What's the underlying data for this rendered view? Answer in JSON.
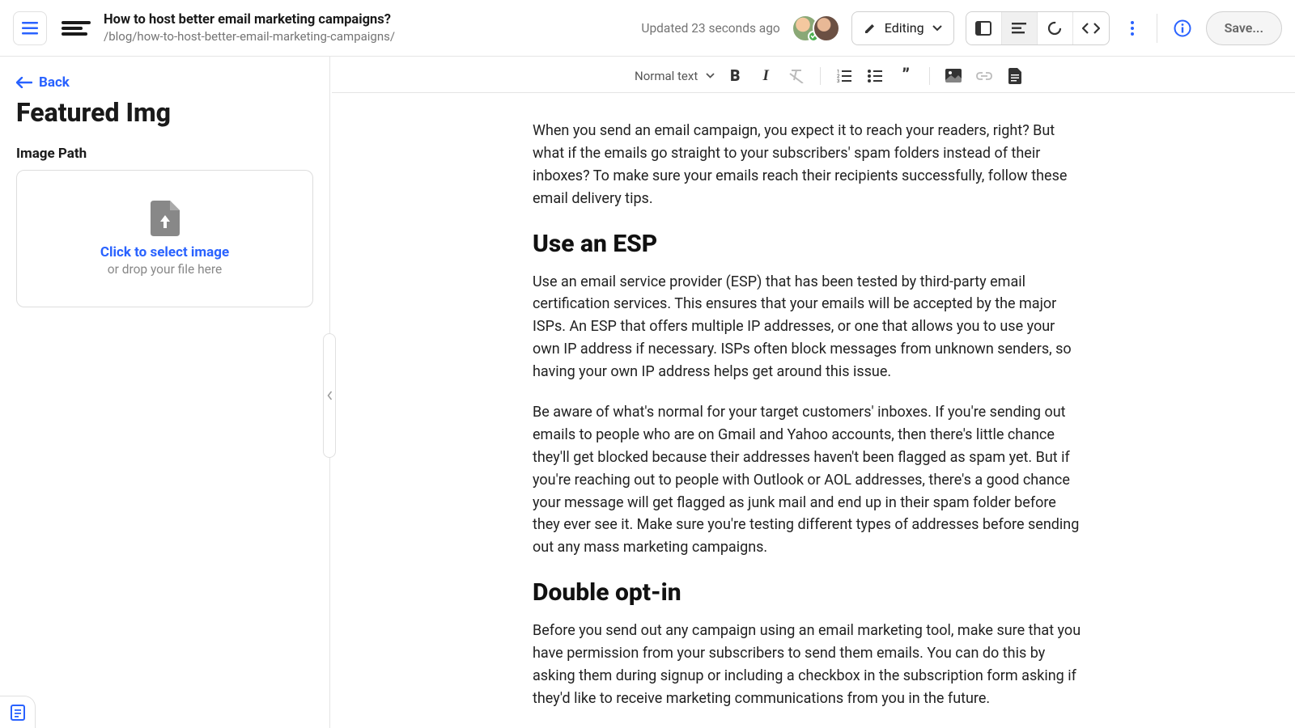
{
  "header": {
    "title": "How to host better email marketing campaigns?",
    "path": "/blog/how-to-host-better-email-marketing-campaigns/",
    "updated": "Updated 23 seconds ago",
    "editing_label": "Editing",
    "save_label": "Save..."
  },
  "toolbar": {
    "style_label": "Normal text"
  },
  "sidebar": {
    "back_label": "Back",
    "panel_title": "Featured Img",
    "field_label": "Image Path",
    "dz_main": "Click to select image",
    "dz_sub": "or drop your file here"
  },
  "content": {
    "p1": "When you send an email campaign, you expect it to reach your readers, right? But what if the emails go straight to your subscribers' spam folders instead of their inboxes? To make sure your emails reach their recipients successfully, follow these email delivery tips.",
    "h1": "Use an ESP",
    "p2": "Use an email service provider (ESP) that has been tested by third-party email certification services. This ensures that your emails will be accepted by the major ISPs. An ESP that offers multiple IP addresses, or one that allows you to use your own IP address if necessary. ISPs often block messages from unknown senders, so having your own IP address helps get around this issue.",
    "p3": "Be aware of what's normal for your target customers' inboxes. If you're sending out emails to people who are on Gmail and Yahoo accounts, then there's little chance they'll get blocked because their addresses haven't been flagged as spam yet. But if you're reaching out to people with Outlook or AOL addresses, there's a good chance your message will get flagged as junk mail and end up in their spam folder before they ever see it. Make sure you're testing different types of addresses before sending out any mass marketing campaigns.",
    "h2": "Double opt-in",
    "p4": "Before you send out any campaign using an email marketing tool, make sure that you have permission from your subscribers to send them emails. You can do this by asking them during signup or including a checkbox in the subscription form asking if they'd like to receive marketing communications from you in the future."
  }
}
